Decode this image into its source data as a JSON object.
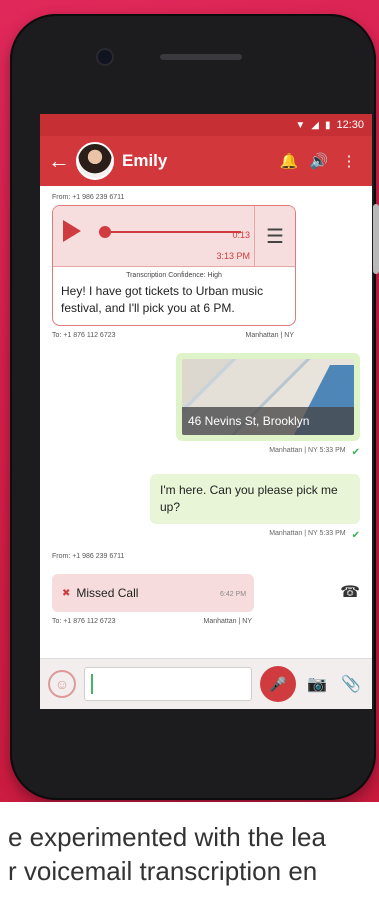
{
  "status": {
    "time": "12:30"
  },
  "header": {
    "contact_name": "Emily"
  },
  "voicemail": {
    "from": "From: +1 986 239 6711",
    "elapsed": "0:13",
    "timestamp": "3:13 PM",
    "confidence": "Transcription Confidence: High",
    "transcript": "Hey! I have got tickets to Urban music festival, and I'll pick you at 6 PM.",
    "to": "To: +1 876 112 6723",
    "location": "Manhattan | NY"
  },
  "location_message": {
    "address": "46 Nevins St, Brooklyn",
    "meta": "Manhattan | NY  5:33 PM"
  },
  "text_message": {
    "text": "I'm here. Can you please pick me up?",
    "meta": "Manhattan | NY  5:33 PM"
  },
  "missed_call": {
    "from": "From: +1 986 239 6711",
    "label": "Missed Call",
    "time": "6:42 PM",
    "to": "To: +1 876 112 6723",
    "location": "Manhattan | NY"
  },
  "composer": {
    "placeholder": ""
  },
  "caption": {
    "line1": "e experimented with the lea",
    "line2": "r voicemail transcription en"
  },
  "colors": {
    "brand": "#d2383b",
    "hero": "#d61f4a",
    "sent_bubble": "#e8f5d7"
  }
}
